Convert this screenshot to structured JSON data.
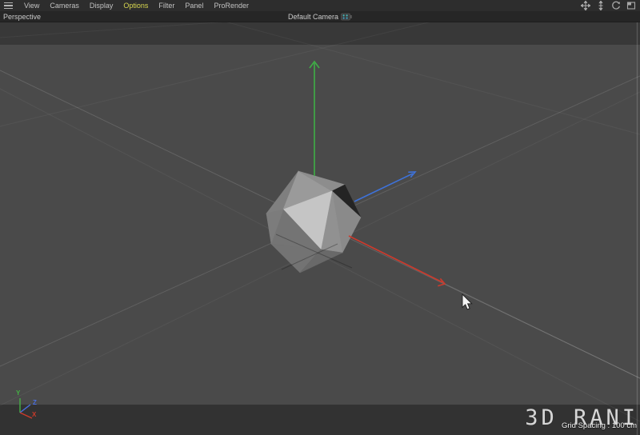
{
  "menubar": {
    "items": [
      "View",
      "Cameras",
      "Display",
      "Options",
      "Filter",
      "Panel",
      "ProRender"
    ],
    "active_item": "Options",
    "active_color": "#d8d74f",
    "text_color": "#c2c2c2",
    "controls": [
      "pan",
      "dolly",
      "rotate",
      "toggle-view"
    ]
  },
  "viewbar": {
    "view_label": "Perspective",
    "camera_label": "Default Camera"
  },
  "viewport": {
    "object": "icosahedron",
    "watermark": "3D RANI",
    "grid_spacing_label": "Grid Spacing : 100 cm",
    "axis_triad": {
      "x_label": "X",
      "y_label": "Y",
      "z_label": "Z"
    },
    "colors": {
      "background": "#4a4a4a",
      "outside_render_band_top": "#383838",
      "outside_render_band_bottom": "#323232",
      "axis_x": "#cd3a2c",
      "axis_y": "#3fae46",
      "axis_z": "#3e72d9",
      "active_menu": "#d8d74f"
    }
  }
}
